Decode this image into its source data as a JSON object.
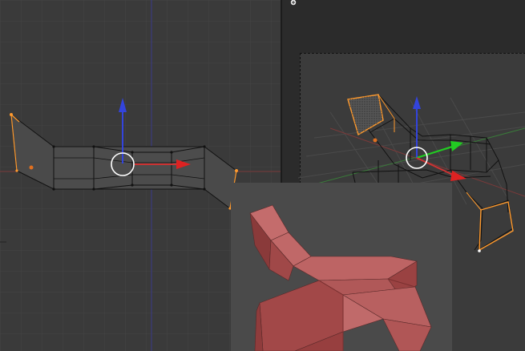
{
  "viewports": {
    "left": {
      "name": "front-ortho-edit-viewport",
      "mode": "edit-mode"
    },
    "right": {
      "name": "perspective-camera-viewport",
      "mode": "edit-mode"
    },
    "inset": {
      "name": "rendered-mesh-preview"
    }
  },
  "colors": {
    "background_left": "#3a3a3a",
    "background_right": "#2b2b2b",
    "grid_line": "#444444",
    "x_axis": "#cc3333",
    "z_axis": "#3344dd",
    "y_axis": "#22cc22",
    "selection": "#ff9a2e",
    "wire": "#111111",
    "mesh_fill": "#4e4e4e",
    "render_surface": "#b05858",
    "render_bg": "#4a4a4a"
  },
  "icons": {
    "corner_widget": "add-plus-icon"
  }
}
